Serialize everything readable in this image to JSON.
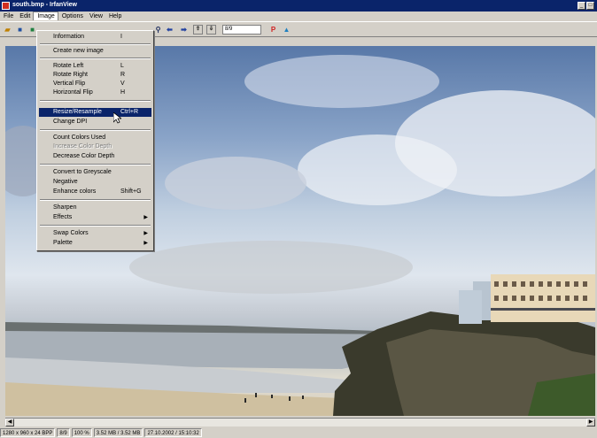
{
  "window": {
    "title": "south.bmp - IrfanView"
  },
  "menubar": {
    "items": [
      "File",
      "Edit",
      "Image",
      "Options",
      "View",
      "Help"
    ]
  },
  "toolbar": {
    "page_value": "8/9",
    "up_label": "⇧",
    "down_label": "⇩"
  },
  "image_menu": {
    "items": [
      {
        "label": "Information",
        "shortcut": "I"
      },
      {
        "label": "Create new image",
        "shortcut": ""
      },
      {
        "label": "Rotate Left",
        "shortcut": "L"
      },
      {
        "label": "Rotate Right",
        "shortcut": "R"
      },
      {
        "label": "Vertical Flip",
        "shortcut": "V"
      },
      {
        "label": "Horizontal Flip",
        "shortcut": "H"
      },
      {
        "label": "Resize/Resample",
        "shortcut": "Ctrl+R"
      },
      {
        "label": "Change DPI",
        "shortcut": ""
      },
      {
        "label": "Count Colors Used",
        "shortcut": ""
      },
      {
        "label": "Increase Color Depth",
        "shortcut": ""
      },
      {
        "label": "Decrease Color Depth",
        "shortcut": ""
      },
      {
        "label": "Convert to Greyscale",
        "shortcut": ""
      },
      {
        "label": "Negative",
        "shortcut": ""
      },
      {
        "label": "Enhance colors",
        "shortcut": "Shift+G"
      },
      {
        "label": "Sharpen",
        "shortcut": ""
      },
      {
        "label": "Effects",
        "shortcut": ""
      },
      {
        "label": "Swap Colors",
        "shortcut": ""
      },
      {
        "label": "Palette",
        "shortcut": ""
      }
    ]
  },
  "statusbar": {
    "dimensions": "1280 x 960 x 24 BPP",
    "index": "8/9",
    "zoom": "100 %",
    "memory": "3.52 MB / 3.52 MB",
    "datetime": "27.10.2002 / 15:10:32"
  },
  "colors": {
    "titlebar": "#0a246a",
    "highlight": "#0a246a",
    "face": "#d4d0c8"
  }
}
